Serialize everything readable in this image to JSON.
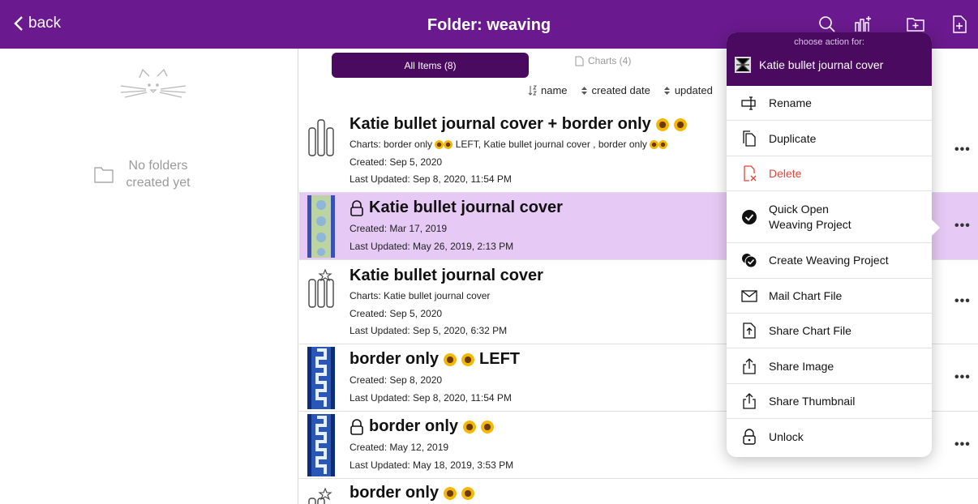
{
  "header": {
    "back_label": "back",
    "title": "Folder: weaving"
  },
  "leftpane": {
    "empty_text": "No folders created yet"
  },
  "segments": {
    "all_label": "All Items (8)",
    "charts_label": "Charts (4)"
  },
  "sort": {
    "name": "name",
    "created": "created date",
    "updated": "updated"
  },
  "items": [
    {
      "title": "Katie bullet journal cover  + border only",
      "charts": "Charts: border only",
      "charts_rest": "LEFT, Katie bullet journal cover , border only",
      "created": "Created: Sep 5, 2020",
      "updated": "Last Updated: Sep 8, 2020, 11:54 PM"
    },
    {
      "title": "Katie bullet journal cover",
      "created": "Created: Mar 17, 2019",
      "updated": "Last Updated: May 26, 2019, 2:13 PM"
    },
    {
      "title": "Katie bullet journal cover",
      "charts": "Charts: Katie bullet journal cover",
      "created": "Created: Sep 5, 2020",
      "updated": "Last Updated: Sep 5, 2020, 6:32 PM"
    },
    {
      "title": "border only",
      "title_suffix": "LEFT",
      "created": "Created: Sep 8, 2020",
      "updated": "Last Updated: Sep 8, 2020, 11:54 PM"
    },
    {
      "title": "border only",
      "created": "Created: May 12, 2019",
      "updated": "Last Updated: May 18, 2019, 3:53 PM"
    },
    {
      "title": "border only"
    }
  ],
  "more_label": "•••",
  "popover": {
    "subtitle": "choose action for:",
    "target": "Katie bullet journal cover",
    "actions": {
      "rename": "Rename",
      "duplicate": "Duplicate",
      "delete": "Delete",
      "quick_open_1": "Quick Open",
      "quick_open_2": "Weaving Project",
      "create": "Create Weaving Project",
      "mail": "Mail Chart File",
      "share_chart": "Share Chart File",
      "share_image": "Share Image",
      "share_thumb": "Share Thumbnail",
      "unlock": "Unlock"
    }
  },
  "colors": {
    "header": "#6a1a8e",
    "accent_dark": "#4a0a60",
    "selected_row": "#e6caf5",
    "danger": "#e0463a"
  }
}
